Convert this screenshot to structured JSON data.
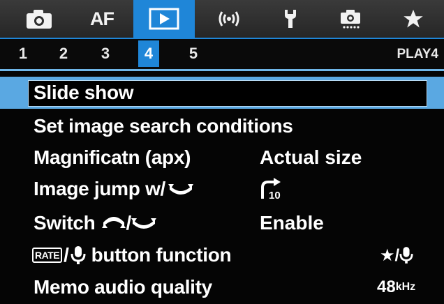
{
  "tabs": [
    {
      "id": "shooting",
      "icon": "camera-icon"
    },
    {
      "id": "af",
      "label": "AF"
    },
    {
      "id": "playback",
      "icon": "play-icon",
      "active": true
    },
    {
      "id": "wireless",
      "icon": "wireless-icon"
    },
    {
      "id": "setup",
      "icon": "wrench-icon"
    },
    {
      "id": "custom",
      "icon": "custom-functions-icon"
    },
    {
      "id": "mymenu",
      "icon": "star-icon"
    }
  ],
  "pages": [
    "1",
    "2",
    "3",
    "4",
    "5"
  ],
  "active_page": "4",
  "menu_title": "PLAY4",
  "items": [
    {
      "label": "Slide show",
      "value": ""
    },
    {
      "label": "Set image search conditions",
      "value": ""
    },
    {
      "label": "Magnificatn (apx)",
      "value": "Actual size"
    },
    {
      "label": "Image jump w/",
      "value_icon": "jump-10-images-icon",
      "value": ""
    },
    {
      "label": "Switch",
      "label_suffix": "/",
      "value": "Enable"
    },
    {
      "label_badge": "RATE",
      "label": "button function",
      "value": "★/"
    },
    {
      "label": "Memo audio quality",
      "value": "48",
      "value_unit": "kHz"
    }
  ],
  "colors": {
    "accent": "#1f86d8",
    "selection": "#5aa8e2",
    "background": "#050505"
  }
}
